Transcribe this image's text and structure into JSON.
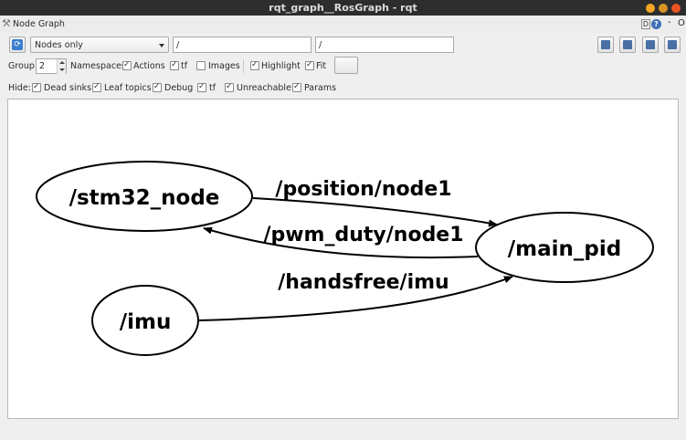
{
  "window": {
    "title": "rqt_graph__RosGraph - rqt"
  },
  "plugin": {
    "title": "Node Graph",
    "dock_d": "D",
    "dock_help": "?",
    "dock_dash": "-",
    "dock_o": "O"
  },
  "toolbar": {
    "mode_select": "Nodes only",
    "filter_include": "/",
    "filter_exclude": "/"
  },
  "options": {
    "group_label": "Group:",
    "group_value": "2",
    "namespaces_label": "Namespaces",
    "actions_label": "Actions",
    "tf_label": "tf",
    "images_label": "Images",
    "highlight_label": "Highlight",
    "fit_label": "Fit"
  },
  "hide": {
    "label": "Hide:",
    "dead_sinks": "Dead sinks",
    "leaf_topics": "Leaf topics",
    "debug": "Debug",
    "tf": "tf",
    "unreachable": "Unreachable",
    "params": "Params"
  },
  "graph": {
    "nodes": {
      "stm32": "/stm32_node",
      "main_pid": "/main_pid",
      "imu": "/imu"
    },
    "edges": {
      "position": "/position/node1",
      "pwm_duty": "/pwm_duty/node1",
      "handsfree": "/handsfree/imu"
    }
  }
}
